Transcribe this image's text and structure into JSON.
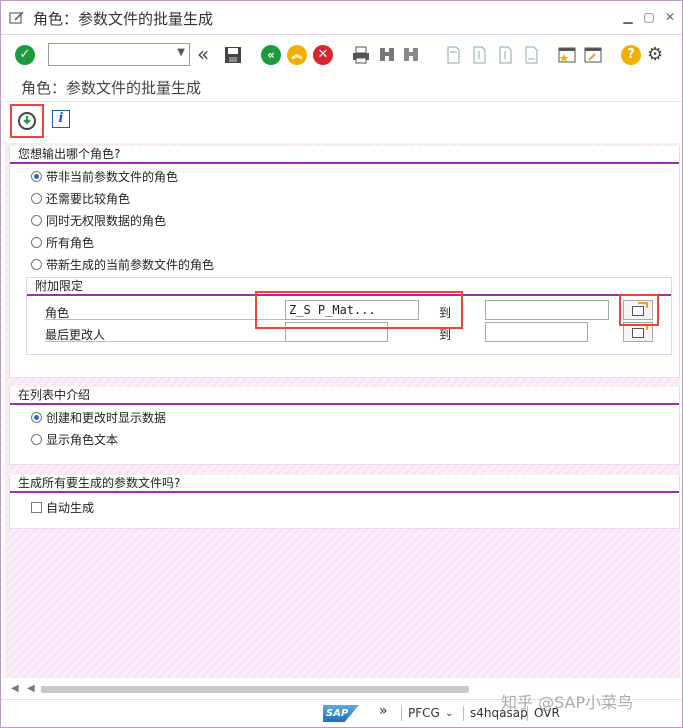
{
  "window": {
    "title": "角色：参数文件的批量生成",
    "icon": "edit-form-icon"
  },
  "toolbar": {
    "command_field_value": "",
    "icons": [
      "enter-icon",
      "back-nav-icon",
      "save-icon",
      "back-icon",
      "exit-icon",
      "cancel-icon",
      "print-icon",
      "find-icon",
      "find-next-icon",
      "first-page-icon",
      "prev-page-icon",
      "next-page-icon",
      "last-page-icon",
      "new-session-icon",
      "shortcut-icon",
      "help-icon",
      "settings-icon"
    ]
  },
  "page_title": "角色：参数文件的批量生成",
  "subbar": {
    "execute_icon": "execute-icon",
    "info_label": "i"
  },
  "group1": {
    "heading": "您想输出哪个角色?",
    "options": [
      {
        "label": "带非当前参数文件的角色",
        "selected": true
      },
      {
        "label": "还需要比较角色",
        "selected": false
      },
      {
        "label": "同时无权限数据的角色",
        "selected": false
      },
      {
        "label": "所有角色",
        "selected": false
      },
      {
        "label": "带新生成的当前参数文件的角色",
        "selected": false
      }
    ],
    "additional": {
      "heading": "附加限定",
      "rows": [
        {
          "label": "角色",
          "from": "Z_S      P_Mat...",
          "to_label": "到",
          "to": ""
        },
        {
          "label": "最后更改人",
          "from": "",
          "to_label": "到",
          "to": ""
        }
      ]
    }
  },
  "group2": {
    "heading": "在列表中介绍",
    "options": [
      {
        "label": "创建和更改时显示数据",
        "selected": true
      },
      {
        "label": "显示角色文本",
        "selected": false
      }
    ]
  },
  "group3": {
    "heading": "生成所有要生成的参数文件吗?",
    "checkbox_label": "自动生成",
    "checked": false
  },
  "statusbar": {
    "logo": "SAP",
    "transaction": "PFCG",
    "system": "s4hqasap",
    "mode": "OVR"
  },
  "watermark": "知乎 @SAP小菜鸟",
  "colors": {
    "accent_purple": "#9b2fae",
    "highlight_red": "#e8463a",
    "enter_green": "#1e9a3e",
    "back_green": "#1e9a3e",
    "exit_yellow": "#f0b000",
    "cancel_red": "#d8262e"
  }
}
